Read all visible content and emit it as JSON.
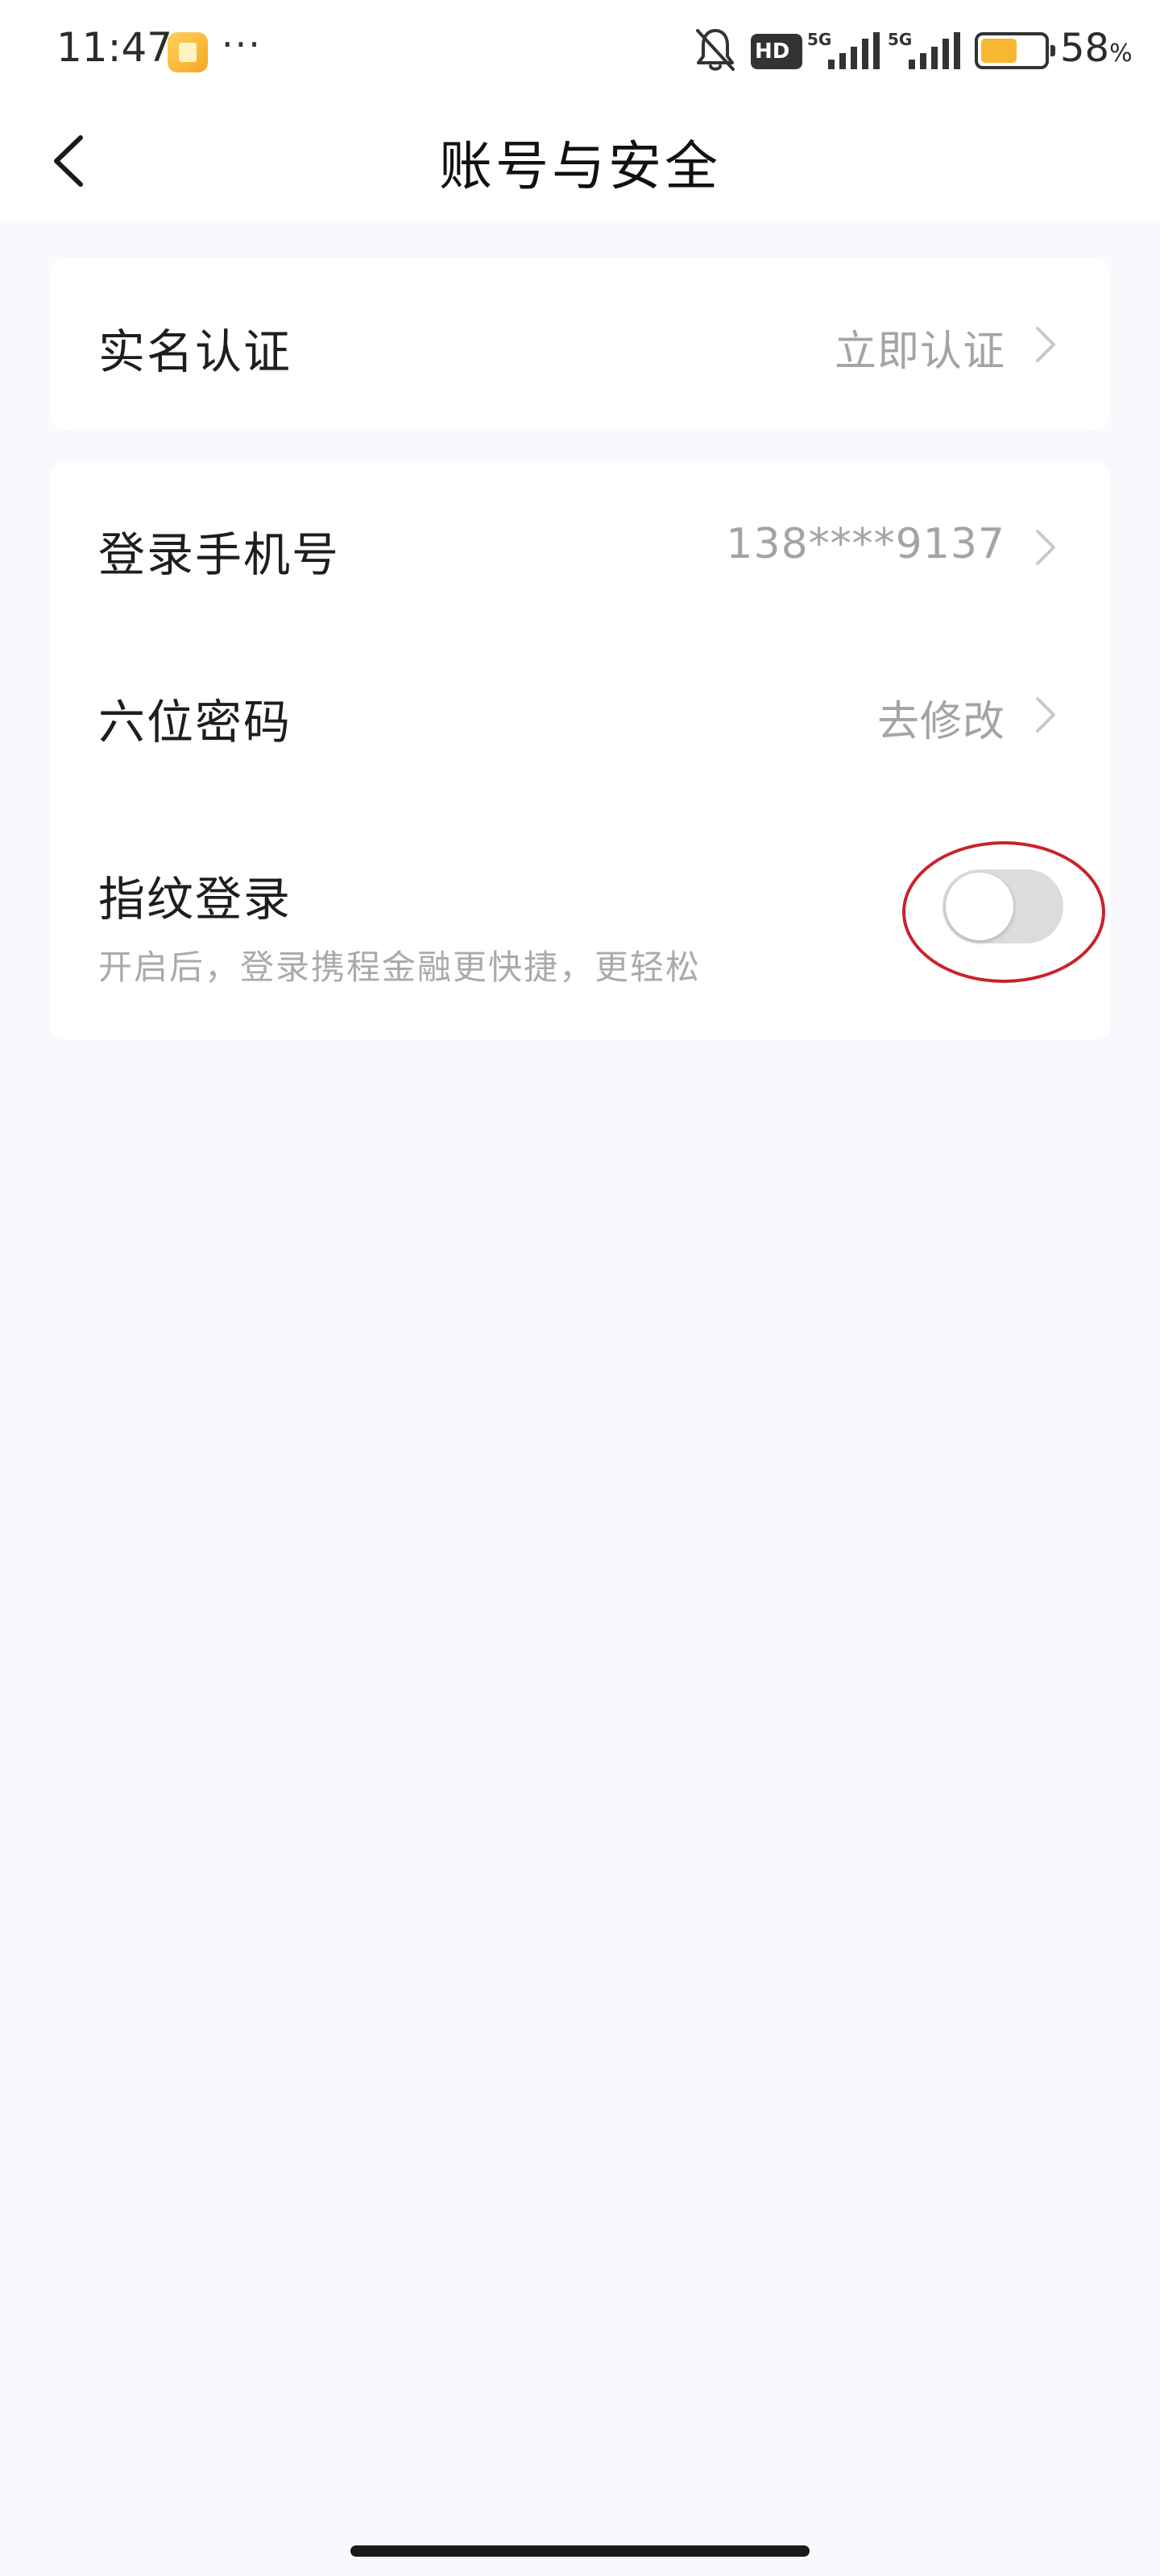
{
  "status_bar": {
    "time": "11:47",
    "dots": "···",
    "hd_label": "HD",
    "signal_1_label": "5G",
    "signal_2_label": "5G",
    "battery_level": 0.58,
    "battery_percent": "58",
    "battery_unit": "%",
    "battery_color": "#f7b731"
  },
  "nav": {
    "back_icon": "chevron-left-icon",
    "title": "账号与安全"
  },
  "card_identity": {
    "realname_label": "实名认证",
    "realname_value": "立即认证"
  },
  "card_security": {
    "phone_label": "登录手机号",
    "phone_value": "138****9137",
    "password_label": "六位密码",
    "password_value": "去修改",
    "fingerprint_label": "指纹登录",
    "fingerprint_desc": "开启后，登录携程金融更快捷，更轻松",
    "fingerprint_enabled": false
  },
  "colors": {
    "background": "#f9f9fd",
    "card": "#ffffff",
    "annotation": "#c8232c",
    "toggle_off": "#dcdcdf"
  }
}
